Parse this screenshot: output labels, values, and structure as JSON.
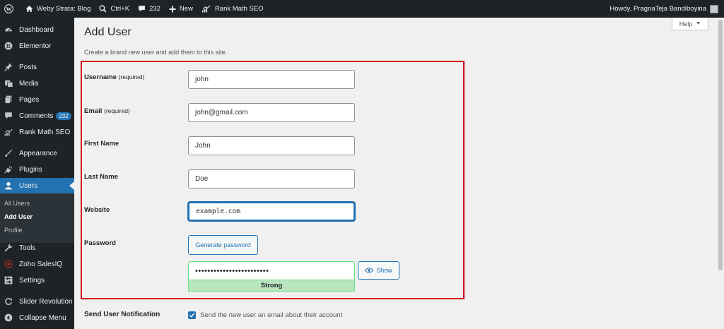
{
  "adminbar": {
    "site_name": "Weby Strata: Blog",
    "shortcut": "Ctrl+K",
    "comment_count": "232",
    "new_label": "New",
    "seo_label": "Rank Math SEO",
    "greeting": "Howdy, PragnaTeja Bandiboyina"
  },
  "sidebar": {
    "dashboard": "Dashboard",
    "elementor": "Elementor",
    "posts": "Posts",
    "media": "Media",
    "pages": "Pages",
    "comments": "Comments",
    "comments_badge": "232",
    "rankmath": "Rank Math SEO",
    "appearance": "Appearance",
    "plugins": "Plugins",
    "users": "Users",
    "submenu": {
      "all_users": "All Users",
      "add_user": "Add User",
      "profile": "Profile"
    },
    "tools": "Tools",
    "zoho": "Zoho SalesIQ",
    "settings": "Settings",
    "slider": "Slider Revolution",
    "collapse": "Collapse Menu"
  },
  "main": {
    "help_label": "Help",
    "title": "Add User",
    "description": "Create a brand new user and add them to this site.",
    "fields": {
      "username": {
        "label": "Username",
        "req": "(required)",
        "value": "john"
      },
      "email": {
        "label": "Email",
        "req": "(required)",
        "value": "john@gmail.com"
      },
      "first_name": {
        "label": "First Name",
        "value": "John"
      },
      "last_name": {
        "label": "Last Name",
        "value": "Doe"
      },
      "website": {
        "label": "Website",
        "value": "example.com"
      },
      "password": {
        "label": "Password",
        "generate_label": "Generate password",
        "value": "••••••••••••••••••••••••",
        "strength": "Strong",
        "show_label": "Show"
      }
    },
    "notification": {
      "label": "Send User Notification",
      "checked": true,
      "text": "Send the new user an email about their account"
    }
  },
  "colors": {
    "adminbar_bg": "#1d2327",
    "accent": "#2271b1",
    "highlight_border": "#d0021b",
    "strength_bg": "#b8e6bf"
  }
}
